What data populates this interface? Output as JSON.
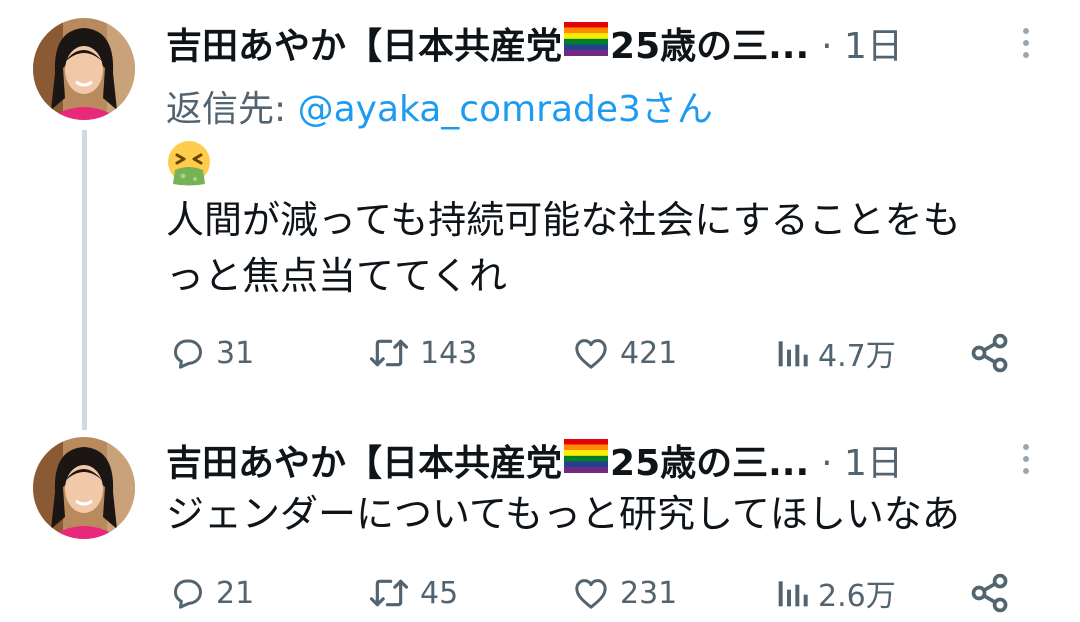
{
  "thread": {
    "tweets": [
      {
        "name": "吉田あやか【日本共産党",
        "name_suffix": "25歳の三...",
        "time": "· 1日",
        "reply_prefix": "返信先: ",
        "reply_handle": "@ayaka_comrade3さん",
        "emoji": "vomiting-face",
        "lines": [
          "人間が減っても持続可能な社会にすることをも",
          "っと焦点当ててくれ"
        ],
        "replies": "31",
        "retweets": "143",
        "likes": "421",
        "views": "4.7万"
      },
      {
        "name": "吉田あやか【日本共産党",
        "name_suffix": "25歳の三...",
        "time": "· 1日",
        "lines": [
          "ジェンダーについてもっと研究してほしいなあ"
        ],
        "replies": "21",
        "retweets": "45",
        "likes": "231",
        "views": "2.6万"
      }
    ]
  },
  "colors": {
    "text": "#0f1419",
    "secondary": "#536471",
    "link": "#1d9bf0",
    "thread_line": "#cfd9de"
  },
  "icons": [
    "reply-icon",
    "retweet-icon",
    "like-icon",
    "views-icon",
    "share-icon",
    "more-icon",
    "rainbow-flag-icon"
  ]
}
